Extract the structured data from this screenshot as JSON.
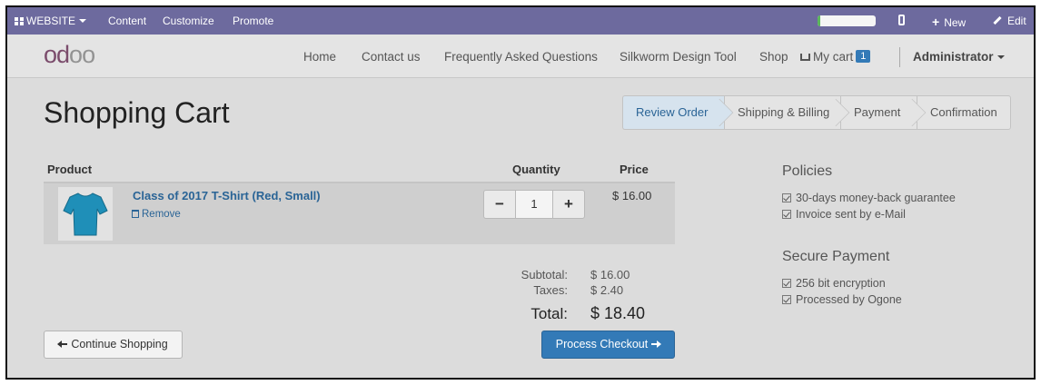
{
  "adminbar": {
    "website": "WEBSITE",
    "content": "Content",
    "customize": "Customize",
    "promote": "Promote",
    "progress": 0.04,
    "new": "New",
    "edit": "Edit"
  },
  "navbar": {
    "logo_main": "od",
    "logo_rest": "oo",
    "home": "Home",
    "contact": "Contact us",
    "faq": "Frequently Asked Questions",
    "silkworm": "Silkworm Design Tool",
    "shop": "Shop",
    "cart": "My cart",
    "cart_count": "1",
    "user": "Administrator"
  },
  "page": {
    "title": "Shopping Cart"
  },
  "wizard": {
    "steps": [
      "Review Order",
      "Shipping & Billing",
      "Payment",
      "Confirmation"
    ],
    "active": "Review Order"
  },
  "cart": {
    "headers": {
      "product": "Product",
      "quantity": "Quantity",
      "price": "Price"
    },
    "items": [
      {
        "name": "Class of 2017 T-Shirt (Red, Small)",
        "remove": "Remove",
        "quantity": "1",
        "price": "$ 16.00",
        "shirt_color": "#1f8fb8"
      }
    ],
    "stepper": {
      "minus": "−",
      "plus": "+"
    },
    "subtotal_label": "Subtotal:",
    "subtotal": "$ 16.00",
    "taxes_label": "Taxes:",
    "taxes": "$ 2.40",
    "total_label": "Total:",
    "total": "$ 18.40",
    "continue": "Continue Shopping",
    "checkout": "Process Checkout"
  },
  "sidebar": {
    "policies_title": "Policies",
    "policies": [
      "30-days money-back guarantee",
      "Invoice sent by e-Mail"
    ],
    "payment_title": "Secure Payment",
    "payment": [
      "256 bit encryption",
      "Processed by Ogone"
    ]
  },
  "colors": {
    "admin_bar": "#6d6a9e",
    "primary": "#337ab7",
    "link": "#2a6496",
    "progress": "#5cb85c"
  }
}
